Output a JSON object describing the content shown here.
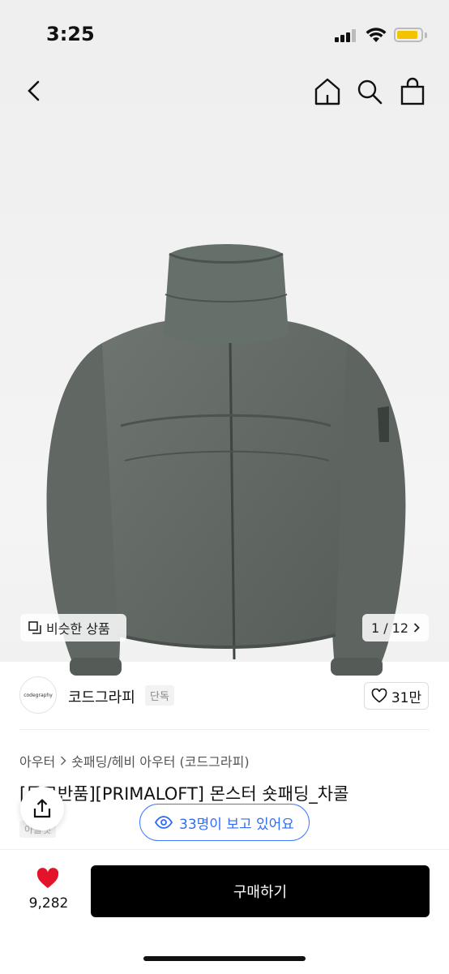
{
  "status": {
    "time": "3:25"
  },
  "gallery": {
    "similar_label": "비슷한 상품",
    "pager": "1 / 12"
  },
  "brand": {
    "logo_text": "codegraphy",
    "name": "코드그라피",
    "badge": "단독",
    "likes": "31만"
  },
  "breadcrumb": {
    "items": [
      "아우터",
      "숏패딩/헤비 아우터 (코드그라피)"
    ]
  },
  "product": {
    "title": "[무료반품][PRIMALOFT] 몬스터 숏패딩_차콜",
    "sub_label": "아울렛"
  },
  "viewers": {
    "text": "33명이 보고 있어요"
  },
  "bottom": {
    "wish_count": "9,282",
    "buy_label": "구매하기"
  },
  "colors": {
    "accent_blue": "#2f6cf5",
    "heart_red": "#e3132b",
    "battery_yellow": "#f2c400",
    "buy_bg": "#000000"
  },
  "icons": [
    "back-icon",
    "home-icon",
    "search-icon",
    "shopping-bag-icon",
    "similar-icon",
    "chevron-right-icon",
    "heart-outline-icon",
    "share-icon",
    "eye-icon",
    "heart-filled-icon"
  ]
}
